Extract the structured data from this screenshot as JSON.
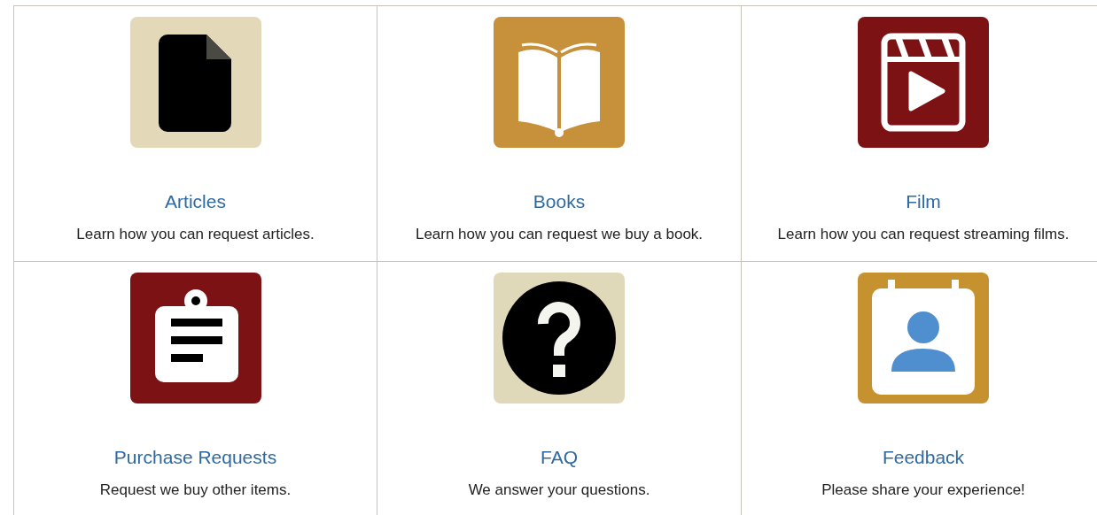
{
  "cards": [
    {
      "kind": "document",
      "color": "#e3d8b7",
      "title": "Articles",
      "description": "Learn how you can request articles."
    },
    {
      "kind": "book",
      "color": "#c6913a",
      "title": "Books",
      "description": "Learn how you can request we buy a book."
    },
    {
      "kind": "film",
      "color": "#7d1214",
      "title": "Film",
      "description": "Learn how you can request streaming films."
    },
    {
      "kind": "clipboard",
      "color": "#7d1214",
      "title": "Purchase Requests",
      "description": "Request we buy other items."
    },
    {
      "kind": "question",
      "color": "#e0d9b9",
      "title": "FAQ",
      "description": "We answer your questions."
    },
    {
      "kind": "contact",
      "color": "#c6912f",
      "title": "Feedback",
      "description": "Please share your experience!"
    }
  ]
}
